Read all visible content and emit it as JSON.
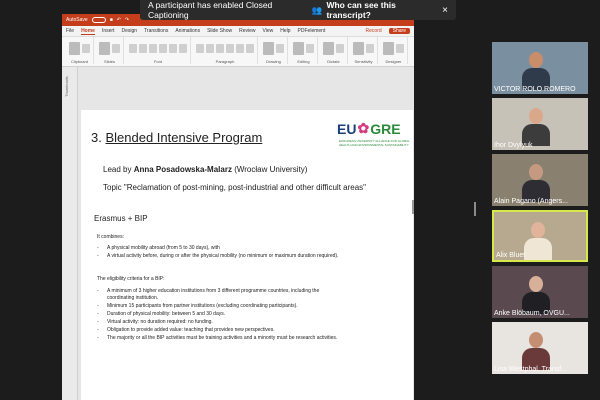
{
  "banner": {
    "message": "A participant has enabled Closed Captioning",
    "who_label": "Who can see this transcript?",
    "close": "×"
  },
  "ppt": {
    "autosave": "AutoSave",
    "tabs": [
      "File",
      "Home",
      "Insert",
      "Design",
      "Transitions",
      "Animations",
      "Slide Show",
      "Review",
      "View",
      "Help",
      "PDFelement"
    ],
    "record": "Record",
    "share": "Share",
    "ribbon_groups": [
      "Clipboard",
      "Slides",
      "Font",
      "Paragraph",
      "Drawing",
      "Editing",
      "Dictate",
      "Sensitivity",
      "Designer"
    ],
    "thumbnails_label": "Thumbnails"
  },
  "slide": {
    "title_num": "3.",
    "title_text": "Blended Intensive Program",
    "logo_eu": "EU",
    "logo_green": "GRE",
    "logo_sub": "EUROPEAN UNIVERSITY ALLIANCE FOR GLOBAL HEALTH AND ENVIRONMENTAL SUSTAINABILITY",
    "lead_prefix": "Lead by",
    "lead_name": "Anna Posadowska-Malarz",
    "lead_inst": "(Wrocław University)",
    "topic": "Topic \"Reclamation of post-mining, post-industrial and other difficult areas\"",
    "erasmus": "Erasmus + BIP",
    "combines": "It combines:",
    "combine_items": [
      "A physical mobility abroad (from 5 to 30 days), with",
      "A virtual activity before, during or after the physical mobility (no minimum or maximum duration required)."
    ],
    "criteria": "The eligibility criteria for a BIP:",
    "criteria_items": [
      "A minimum of 3 higher education institutions from 3 different programme countries, including the coordinating institution.",
      "Minimum 15 participants from partner institutions (excluding coordinating participants).",
      "Duration of physical mobility: between 5 and 30 days.",
      "Virtual activity: no duration required: no funding.",
      "Obligation to provide added value: teaching that provides new perspectives.",
      "The majority or all the BIP activities must be training activities and a minority must be research activities."
    ]
  },
  "participants": [
    {
      "name": "VICTOR ROLO ROMERO",
      "bg": "#7a8fa0",
      "skin": "#c98d6a",
      "shirt": "#2f3a4a"
    },
    {
      "name": "Ihor Dvylyuk",
      "bg": "#c7c2b8",
      "skin": "#d9a88a",
      "shirt": "#3c3c3c"
    },
    {
      "name": "Alain Pagano (Angers...",
      "bg": "#8a8070",
      "skin": "#c59a80",
      "shirt": "#2d2d33"
    },
    {
      "name": "Alix Bluet",
      "bg": "#b7a98f",
      "skin": "#e0b49a",
      "shirt": "#efe6d6"
    },
    {
      "name": "Anke Blöbaum, OVGU...",
      "bg": "#5a4a4f",
      "skin": "#d8b09a",
      "shirt": "#1f1f24"
    },
    {
      "name": "Lisa Westphal, Transf...",
      "bg": "#e8e4e0",
      "skin": "#c48e72",
      "shirt": "#6a3a3a"
    }
  ]
}
